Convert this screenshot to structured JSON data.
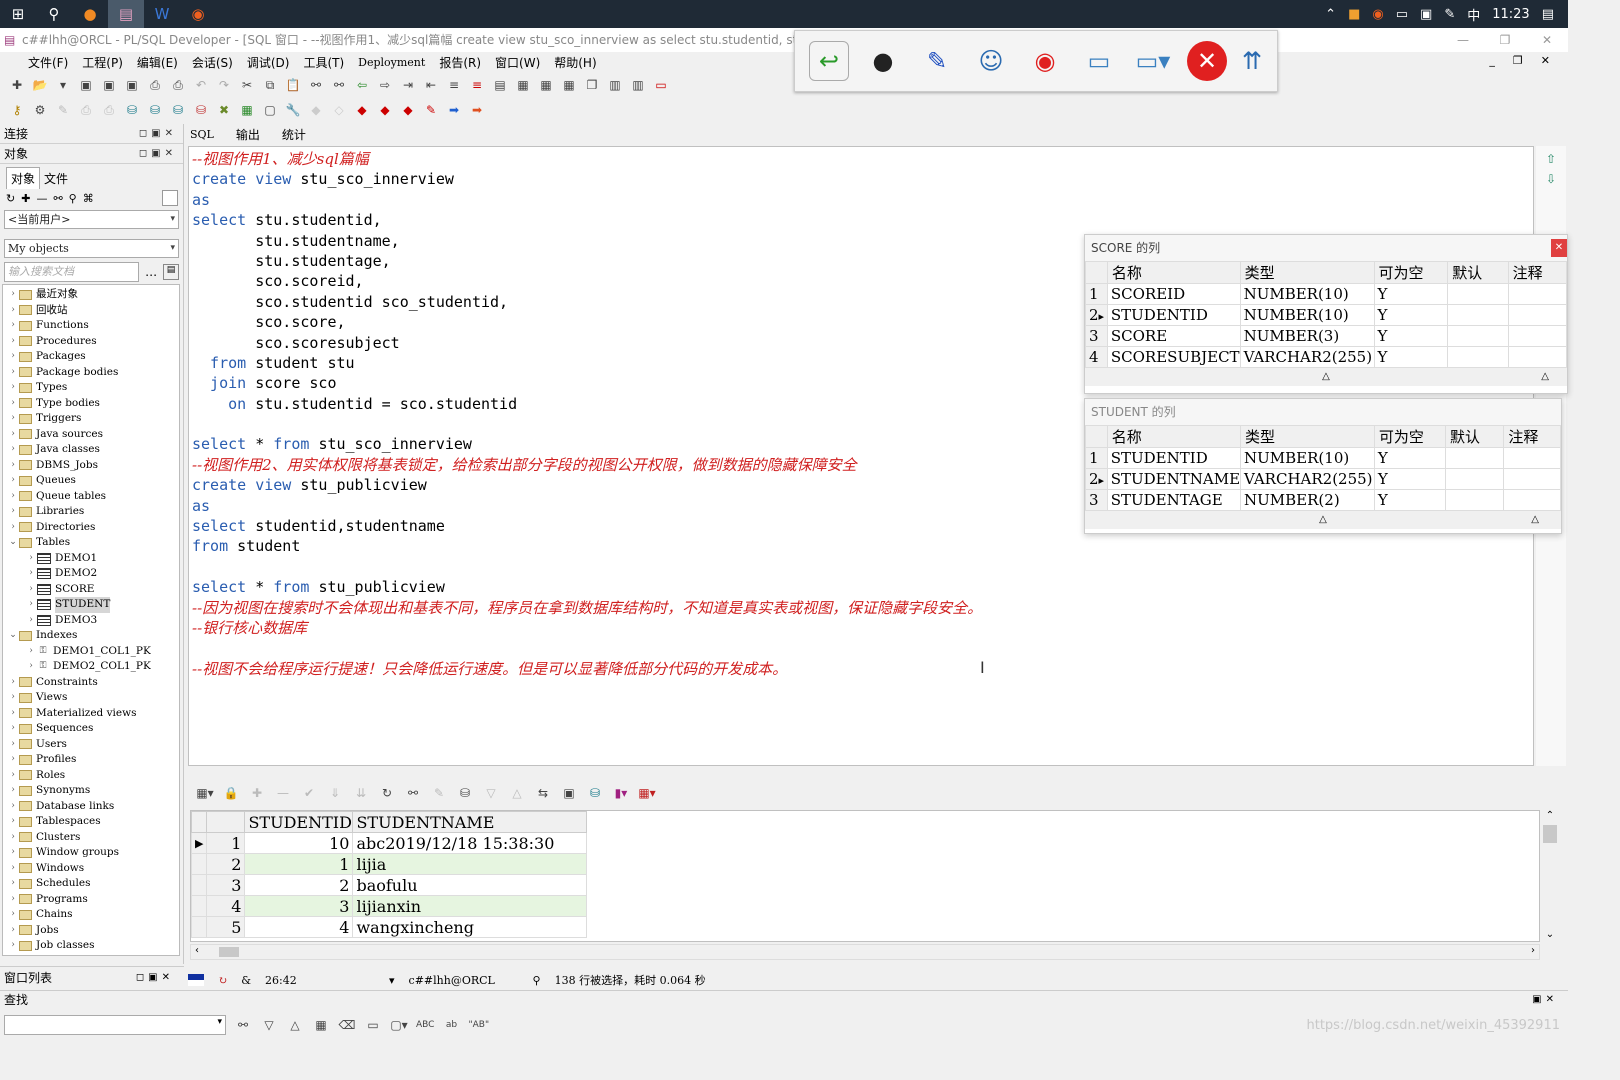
{
  "taskbar": {
    "time": "11:23",
    "ime": "中"
  },
  "window": {
    "title": "c##lhh@ORCL - PL/SQL Developer - [SQL 窗口 - --视图作用1、减少sql篇幅 create view stu_sco_innerview as select stu.studentid, stu.studen"
  },
  "menu": [
    "文件(F)",
    "工程(P)",
    "编辑(E)",
    "会话(S)",
    "调试(D)",
    "工具(T)",
    "Deployment",
    "报告(R)",
    "窗口(W)",
    "帮助(H)"
  ],
  "left": {
    "connection_label": "连接",
    "objects_label": "对象",
    "tab_objects": "对象",
    "tab_files": "文件",
    "user_combo": "<当前用户>",
    "filter_combo": "My objects",
    "search_placeholder": "输入搜索文档",
    "tree": [
      {
        "label": "最近对象",
        "type": "folder",
        "level": 0,
        "exp": "›"
      },
      {
        "label": "回收站",
        "type": "folder",
        "level": 0,
        "exp": "›"
      },
      {
        "label": "Functions",
        "type": "folder",
        "level": 0,
        "exp": "›"
      },
      {
        "label": "Procedures",
        "type": "folder",
        "level": 0,
        "exp": "›"
      },
      {
        "label": "Packages",
        "type": "folder",
        "level": 0,
        "exp": "›"
      },
      {
        "label": "Package bodies",
        "type": "folder",
        "level": 0,
        "exp": "›"
      },
      {
        "label": "Types",
        "type": "folder",
        "level": 0,
        "exp": "›"
      },
      {
        "label": "Type bodies",
        "type": "folder",
        "level": 0,
        "exp": "›"
      },
      {
        "label": "Triggers",
        "type": "folder",
        "level": 0,
        "exp": "›"
      },
      {
        "label": "Java sources",
        "type": "folder",
        "level": 0,
        "exp": "›"
      },
      {
        "label": "Java classes",
        "type": "folder",
        "level": 0,
        "exp": "›"
      },
      {
        "label": "DBMS_Jobs",
        "type": "folder",
        "level": 0,
        "exp": "›"
      },
      {
        "label": "Queues",
        "type": "folder",
        "level": 0,
        "exp": "›"
      },
      {
        "label": "Queue tables",
        "type": "folder",
        "level": 0,
        "exp": "›"
      },
      {
        "label": "Libraries",
        "type": "folder",
        "level": 0,
        "exp": "›"
      },
      {
        "label": "Directories",
        "type": "folder",
        "level": 0,
        "exp": "›"
      },
      {
        "label": "Tables",
        "type": "folder",
        "level": 0,
        "exp": "⌄"
      },
      {
        "label": "DEMO1",
        "type": "table",
        "level": 1,
        "exp": "›"
      },
      {
        "label": "DEMO2",
        "type": "table",
        "level": 1,
        "exp": "›"
      },
      {
        "label": "SCORE",
        "type": "table",
        "level": 1,
        "exp": "›"
      },
      {
        "label": "STUDENT",
        "type": "table",
        "level": 1,
        "exp": "›",
        "selected": true
      },
      {
        "label": "DEMO3",
        "type": "table",
        "level": 1,
        "exp": "›"
      },
      {
        "label": "Indexes",
        "type": "folder",
        "level": 0,
        "exp": "⌄"
      },
      {
        "label": "DEMO1_COL1_PK",
        "type": "index",
        "level": 1,
        "exp": "›"
      },
      {
        "label": "DEMO2_COL1_PK",
        "type": "index",
        "level": 1,
        "exp": "›"
      },
      {
        "label": "Constraints",
        "type": "folder",
        "level": 0,
        "exp": "›"
      },
      {
        "label": "Views",
        "type": "folder",
        "level": 0,
        "exp": "›"
      },
      {
        "label": "Materialized views",
        "type": "folder",
        "level": 0,
        "exp": "›"
      },
      {
        "label": "Sequences",
        "type": "folder",
        "level": 0,
        "exp": "›"
      },
      {
        "label": "Users",
        "type": "folder",
        "level": 0,
        "exp": "›"
      },
      {
        "label": "Profiles",
        "type": "folder",
        "level": 0,
        "exp": "›"
      },
      {
        "label": "Roles",
        "type": "folder",
        "level": 0,
        "exp": "›"
      },
      {
        "label": "Synonyms",
        "type": "folder",
        "level": 0,
        "exp": "›"
      },
      {
        "label": "Database links",
        "type": "folder",
        "level": 0,
        "exp": "›"
      },
      {
        "label": "Tablespaces",
        "type": "folder",
        "level": 0,
        "exp": "›"
      },
      {
        "label": "Clusters",
        "type": "folder",
        "level": 0,
        "exp": "›"
      },
      {
        "label": "Window groups",
        "type": "folder",
        "level": 0,
        "exp": "›"
      },
      {
        "label": "Windows",
        "type": "folder",
        "level": 0,
        "exp": "›"
      },
      {
        "label": "Schedules",
        "type": "folder",
        "level": 0,
        "exp": "›"
      },
      {
        "label": "Programs",
        "type": "folder",
        "level": 0,
        "exp": "›"
      },
      {
        "label": "Chains",
        "type": "folder",
        "level": 0,
        "exp": "›"
      },
      {
        "label": "Jobs",
        "type": "folder",
        "level": 0,
        "exp": "›"
      },
      {
        "label": "Job classes",
        "type": "folder",
        "level": 0,
        "exp": "›"
      }
    ],
    "window_list_label": "窗口列表"
  },
  "editor": {
    "tabs": [
      "SQL",
      "输出",
      "统计"
    ],
    "lines": [
      [
        {
          "t": "--视图作用1、减少sql篇幅",
          "c": "cm"
        }
      ],
      [
        {
          "t": "create view ",
          "c": "kw"
        },
        {
          "t": "stu_sco_innerview",
          "c": ""
        }
      ],
      [
        {
          "t": "as",
          "c": "kw"
        }
      ],
      [
        {
          "t": "select ",
          "c": "kw"
        },
        {
          "t": "stu.studentid,",
          "c": ""
        }
      ],
      [
        {
          "t": "       stu.studentname,",
          "c": ""
        }
      ],
      [
        {
          "t": "       stu.studentage,",
          "c": ""
        }
      ],
      [
        {
          "t": "       sco.scoreid,",
          "c": ""
        }
      ],
      [
        {
          "t": "       sco.studentid sco_studentid,",
          "c": ""
        }
      ],
      [
        {
          "t": "       sco.score,",
          "c": ""
        }
      ],
      [
        {
          "t": "       sco.scoresubject",
          "c": ""
        }
      ],
      [
        {
          "t": "  from ",
          "c": "kw"
        },
        {
          "t": "student stu",
          "c": ""
        }
      ],
      [
        {
          "t": "  join ",
          "c": "kw"
        },
        {
          "t": "score sco",
          "c": ""
        }
      ],
      [
        {
          "t": "    on ",
          "c": "kw"
        },
        {
          "t": "stu.studentid = sco.studentid",
          "c": ""
        }
      ],
      [
        {
          "t": "",
          "c": ""
        }
      ],
      [
        {
          "t": "select ",
          "c": "kw"
        },
        {
          "t": "* ",
          "c": ""
        },
        {
          "t": "from ",
          "c": "kw"
        },
        {
          "t": "stu_sco_innerview",
          "c": ""
        }
      ],
      [
        {
          "t": "--视图作用2、用实体权限将基表锁定，给检索出部分字段的视图公开权限，做到数据的隐藏保障安全",
          "c": "cm"
        }
      ],
      [
        {
          "t": "create view ",
          "c": "kw"
        },
        {
          "t": "stu_publicview",
          "c": ""
        }
      ],
      [
        {
          "t": "as",
          "c": "kw"
        }
      ],
      [
        {
          "t": "select ",
          "c": "kw"
        },
        {
          "t": "studentid,studentname",
          "c": ""
        }
      ],
      [
        {
          "t": "from ",
          "c": "kw"
        },
        {
          "t": "student",
          "c": ""
        }
      ],
      [
        {
          "t": "",
          "c": ""
        }
      ],
      [
        {
          "t": "select ",
          "c": "kw"
        },
        {
          "t": "* ",
          "c": ""
        },
        {
          "t": "from ",
          "c": "kw"
        },
        {
          "t": "stu_publicview",
          "c": ""
        }
      ],
      [
        {
          "t": "--因为视图在搜索时不会体现出和基表不同，程序员在拿到数据库结构时，不知道是真实表或视图，保证隐藏字段安全。",
          "c": "cm"
        }
      ],
      [
        {
          "t": "--银行核心数据库",
          "c": "cm"
        }
      ],
      [
        {
          "t": "",
          "c": ""
        }
      ],
      [
        {
          "t": "--视图不会给程序运行提速！只会降低运行速度。但是可以显著降低部分代码的开发成本。",
          "c": "cm"
        }
      ]
    ]
  },
  "score_popup": {
    "title": "SCORE 的列",
    "headers": [
      "名称",
      "类型",
      "可为空",
      "默认",
      "注释"
    ],
    "rows": [
      {
        "n": "1",
        "name": "SCOREID",
        "type": "NUMBER(10)",
        "null": "Y"
      },
      {
        "n": "2",
        "name": "STUDENTID",
        "type": "NUMBER(10)",
        "null": "Y",
        "cur": true
      },
      {
        "n": "3",
        "name": "SCORE",
        "type": "NUMBER(3)",
        "null": "Y"
      },
      {
        "n": "4",
        "name": "SCORESUBJECT",
        "type": "VARCHAR2(255)",
        "null": "Y"
      }
    ]
  },
  "student_popup": {
    "title": "STUDENT 的列",
    "headers": [
      "名称",
      "类型",
      "可为空",
      "默认",
      "注释"
    ],
    "rows": [
      {
        "n": "1",
        "name": "STUDENTID",
        "type": "NUMBER(10)",
        "null": "Y"
      },
      {
        "n": "2",
        "name": "STUDENTNAME",
        "type": "VARCHAR2(255)",
        "null": "Y",
        "cur": true
      },
      {
        "n": "3",
        "name": "STUDENTAGE",
        "type": "NUMBER(2)",
        "null": "Y"
      }
    ]
  },
  "results": {
    "headers": [
      "STUDENTID",
      "STUDENTNAME"
    ],
    "rows": [
      {
        "n": "1",
        "id": "10",
        "name": "abc2019/12/18 15:38:30",
        "cur": true
      },
      {
        "n": "2",
        "id": "1",
        "name": "lijia"
      },
      {
        "n": "3",
        "id": "2",
        "name": "baofulu"
      },
      {
        "n": "4",
        "id": "3",
        "name": "lijianxin"
      },
      {
        "n": "5",
        "id": "4",
        "name": "wangxincheng"
      }
    ]
  },
  "status": {
    "position": "26:42",
    "connection": "c##lhh@ORCL",
    "message": "138 行被选择，耗时 0.064 秒"
  },
  "find": {
    "label": "查找",
    "abc": "ABC",
    "ab_quoted": "\"AB\""
  },
  "watermark": "https://blog.csdn.net/weixin_45392911",
  "colors": {
    "keyword": "#2a5db0",
    "comment": "#d02020",
    "alt_row": "#e6f5e0"
  }
}
